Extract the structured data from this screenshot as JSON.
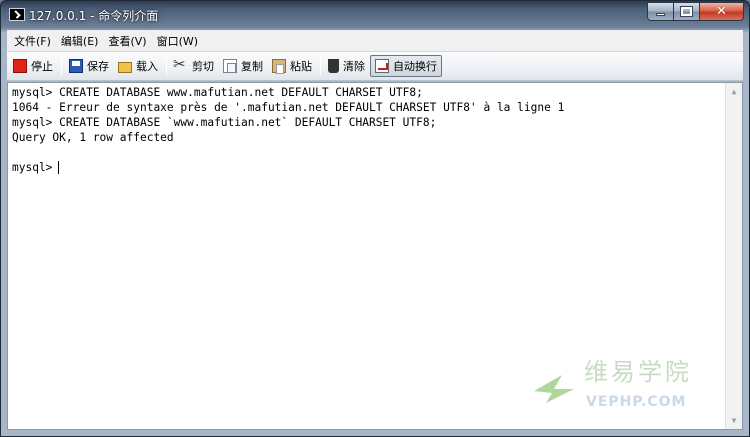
{
  "window": {
    "title": "127.0.0.1 - 命令列介面",
    "icon": "console-icon",
    "controls": [
      "minimize-icon",
      "maximize-icon",
      "close-icon"
    ]
  },
  "menu": {
    "items": [
      "文件(F)",
      "编辑(E)",
      "查看(V)",
      "窗口(W)"
    ]
  },
  "toolbar": {
    "stop": "停止",
    "save": "保存",
    "load": "载入",
    "cut": "剪切",
    "copy": "复制",
    "paste": "粘贴",
    "clear": "清除",
    "wrap": "自动换行"
  },
  "console": {
    "lines": [
      "mysql> CREATE DATABASE www.mafutian.net DEFAULT CHARSET UTF8;",
      "1064 - Erreur de syntaxe près de '.mafutian.net DEFAULT CHARSET UTF8' à la ligne 1",
      "mysql> CREATE DATABASE `www.mafutian.net` DEFAULT CHARSET UTF8;",
      "Query OK, 1 row affected",
      ""
    ],
    "prompt": "mysql>"
  },
  "watermark": {
    "cn": "维易学院",
    "en": "VEPHP.COM"
  }
}
